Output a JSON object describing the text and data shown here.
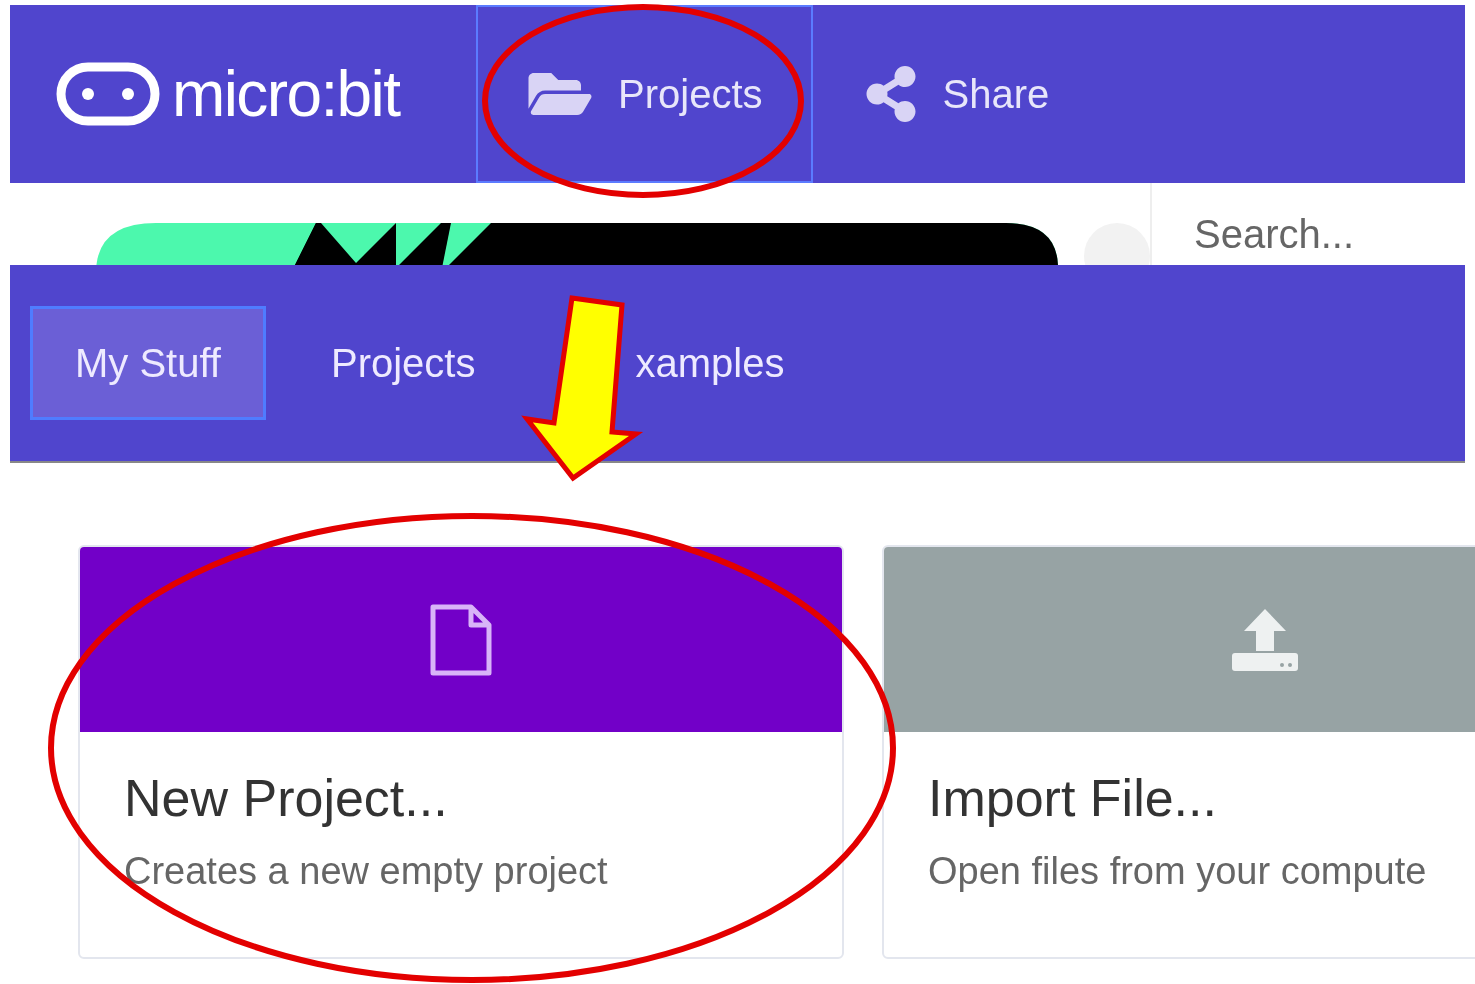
{
  "header": {
    "logo": "micro:bit",
    "items": [
      {
        "label": "Projects",
        "kind": "folder",
        "selected": true
      },
      {
        "label": "Share",
        "kind": "share",
        "selected": false
      }
    ]
  },
  "search": {
    "placeholder": "Search..."
  },
  "tabs": [
    {
      "label": "My Stuff",
      "selected": true
    },
    {
      "label": "Projects",
      "selected": false
    },
    {
      "label": "xamples",
      "selected": false
    }
  ],
  "cards": [
    {
      "title": "New Project...",
      "description": "Creates a new empty project",
      "kind": "new",
      "color": "#7200c8"
    },
    {
      "title": "Import File...",
      "description": "Open files from your compute",
      "kind": "import",
      "color": "#97a3a4"
    }
  ]
}
